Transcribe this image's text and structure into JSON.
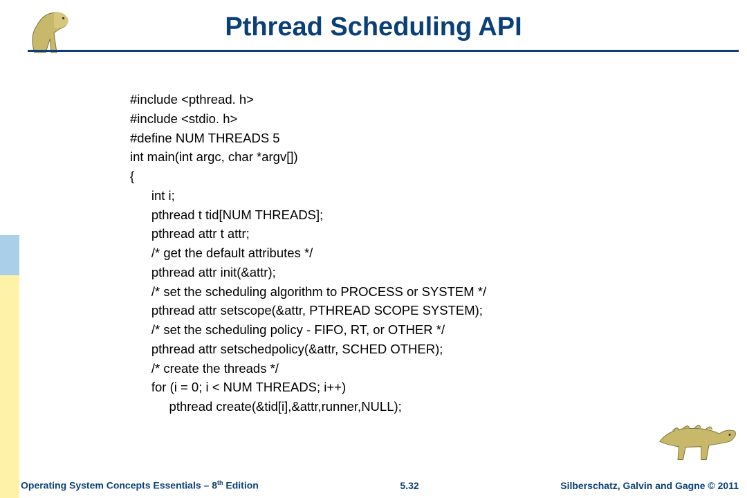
{
  "title": "Pthread Scheduling API",
  "code": "#include <pthread. h>\n#include <stdio. h>\n#define NUM THREADS 5\nint main(int argc, char *argv[])\n{\n      int i;\n      pthread t tid[NUM THREADS];\n      pthread attr t attr;\n      /* get the default attributes */\n      pthread attr init(&attr);\n      /* set the scheduling algorithm to PROCESS or SYSTEM */\n      pthread attr setscope(&attr, PTHREAD SCOPE SYSTEM);\n      /* set the scheduling policy - FIFO, RT, or OTHER */\n      pthread attr setschedpolicy(&attr, SCHED OTHER);\n      /* create the threads */\n      for (i = 0; i < NUM THREADS; i++)\n           pthread create(&tid[i],&attr,runner,NULL);",
  "footer": {
    "left_a": "Operating System Concepts Essentials – 8",
    "left_sup": "th",
    "left_b": " Edition",
    "center": "5.32",
    "right": "Silberschatz, Galvin and Gagne © 2011"
  }
}
